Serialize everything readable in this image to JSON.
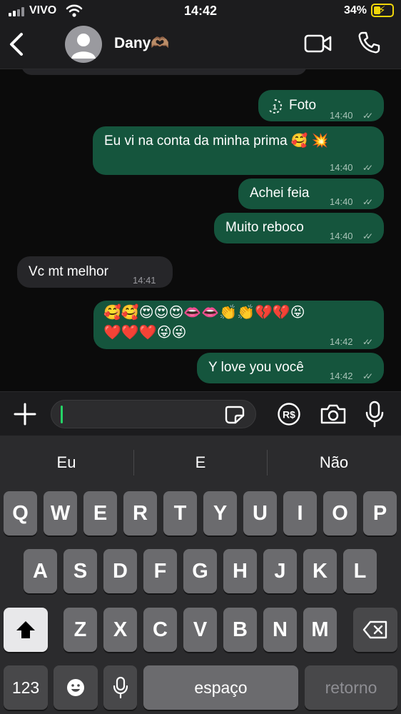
{
  "status_bar": {
    "carrier": "VIVO",
    "time": "14:42",
    "battery": "34%"
  },
  "header": {
    "contact_name": "Dany🫶🏽"
  },
  "messages": [
    {
      "text": "Foto",
      "time": "14:40"
    },
    {
      "text": "Eu vi na conta da minha prima 🥰 💥",
      "time": "14:40"
    },
    {
      "text": "Achei feia",
      "time": "14:40"
    },
    {
      "text": "Muito reboco",
      "time": "14:40"
    },
    {
      "text": "Vc mt melhor",
      "time": "14:41"
    },
    {
      "text": "🥰🥰😍😍😍👄👄👏👏💔💔😝",
      "text2": "❤️❤️❤️😜😜",
      "time": "14:42"
    },
    {
      "text": "Y love you você",
      "time": "14:42"
    }
  ],
  "input": {
    "placeholder": ""
  },
  "keyboard": {
    "suggestions": [
      "Eu",
      "E",
      "Não"
    ],
    "row1": [
      "Q",
      "W",
      "E",
      "R",
      "T",
      "Y",
      "U",
      "I",
      "O",
      "P"
    ],
    "row2": [
      "A",
      "S",
      "D",
      "F",
      "G",
      "H",
      "J",
      "K",
      "L"
    ],
    "row3": [
      "Z",
      "X",
      "C",
      "V",
      "B",
      "N",
      "M"
    ],
    "numbers_label": "123",
    "space_label": "espaço",
    "return_label": "retorno"
  },
  "icons": [
    "signal-icon",
    "wifi-icon",
    "battery-icon",
    "back-icon",
    "avatar-icon",
    "video-icon",
    "phone-icon",
    "view-once-icon",
    "read-ticks-icon",
    "plus-icon",
    "sticker-icon",
    "payment-icon",
    "camera-icon",
    "microphone-icon",
    "shift-icon",
    "emoji-icon",
    "dictation-icon",
    "backspace-icon"
  ],
  "colors": {
    "outgoing_bubble": "#15553d",
    "incoming_bubble": "#262629",
    "caret": "#25d366",
    "battery": "#f0d60a"
  }
}
